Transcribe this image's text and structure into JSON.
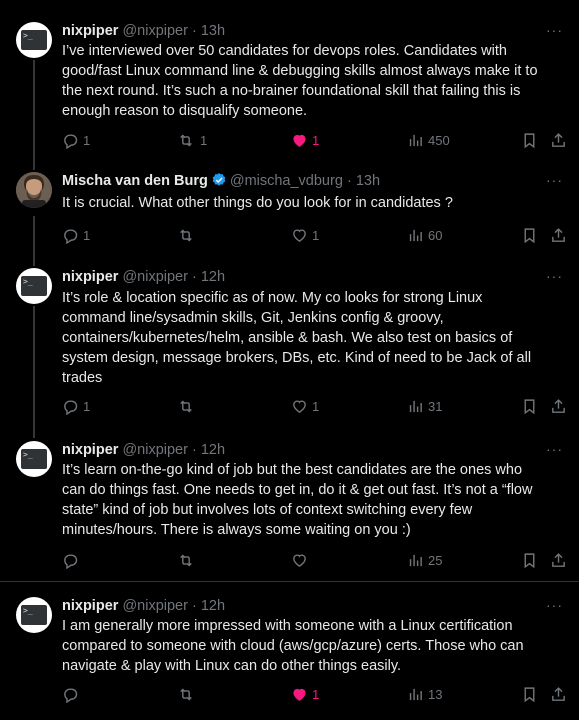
{
  "tweets": [
    {
      "name": "nixpiper",
      "handle": "@nixpiper",
      "time": "13h",
      "avatar": "terminal-icon",
      "text_lines": [
        "I’ve interviewed over 50 candidates for devops roles. Candidates with",
        "good/fast Linux command line & debugging skills almost always make it to",
        "the next round. It’s such a no-brainer foundational skill that failing this is",
        "enough reason to disqualify someone."
      ],
      "replies": "1",
      "retweets": "1",
      "likes": "1",
      "liked": true,
      "views": "450"
    },
    {
      "name": "Mischa van den Burg",
      "handle": "@mischa_vdburg",
      "time": "13h",
      "verified": true,
      "avatar": "profile-photo",
      "text_lines": [
        "It is crucial. What other things do you look for in candidates ?"
      ],
      "replies": "1",
      "retweets": "",
      "likes": "1",
      "liked": false,
      "views": "60"
    },
    {
      "name": "nixpiper",
      "handle": "@nixpiper",
      "time": "12h",
      "avatar": "terminal-icon",
      "text_lines": [
        "It’s role & location specific as of now. My co looks for strong Linux",
        "command line/sysadmin skills, Git, Jenkins config & groovy,",
        "containers/kubernetes/helm, ansible & bash. We also test on basics of",
        "system design, message brokers, DBs, etc. Kind of need to be Jack of all",
        "trades"
      ],
      "replies": "1",
      "retweets": "",
      "likes": "1",
      "liked": false,
      "views": "31"
    },
    {
      "name": "nixpiper",
      "handle": "@nixpiper",
      "time": "12h",
      "avatar": "terminal-icon",
      "text_lines": [
        "It’s learn on-the-go kind of job but the best candidates are the ones who",
        "can do things fast. One needs to get in, do it & get out fast. It’s not a “flow",
        "state” kind of job but involves lots of context switching every few",
        "minutes/hours. There is always some waiting on you :)"
      ],
      "replies": "",
      "retweets": "",
      "likes": "",
      "liked": false,
      "views": "25"
    },
    {
      "name": "nixpiper",
      "handle": "@nixpiper",
      "time": "12h",
      "avatar": "terminal-icon",
      "text_lines": [
        "I am generally more impressed with someone with a Linux certification",
        "compared to someone with cloud (aws/gcp/azure) certs. Those who can",
        "navigate & play with Linux can do other things easily."
      ],
      "replies": "",
      "retweets": "",
      "likes": "1",
      "liked": true,
      "views": "13"
    }
  ],
  "separator": "·",
  "more_label": "···",
  "prompt_glyph": ">_",
  "colors": {
    "like": "#f91880",
    "verified": "#1d9bf0",
    "muted": "#71767b"
  }
}
